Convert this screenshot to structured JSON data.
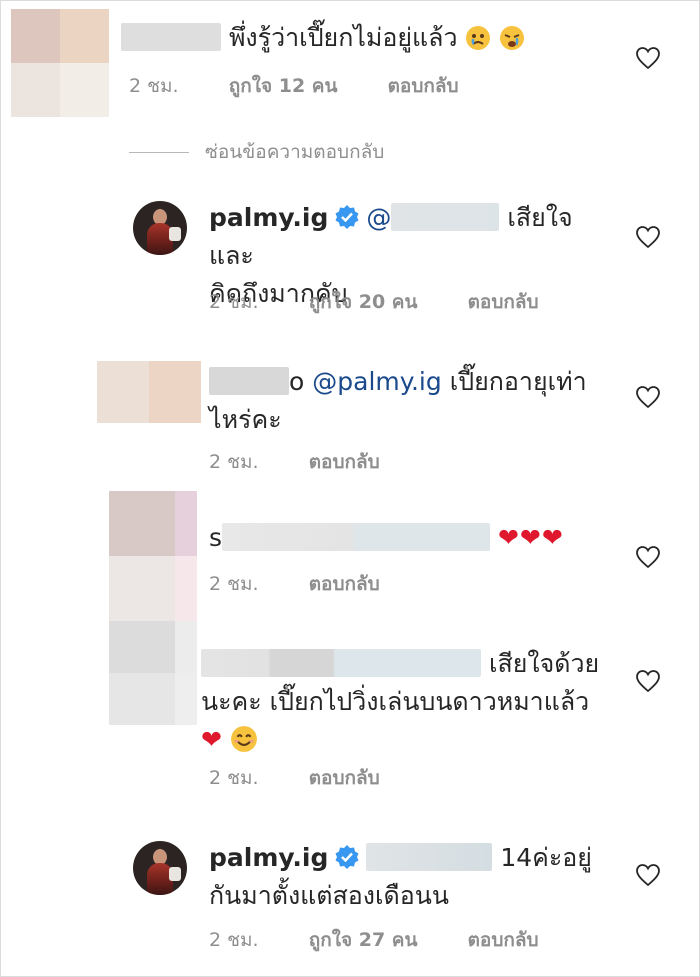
{
  "comments": [
    {
      "text": "พึ่งรู้ว่าเปี๊ยกไม่อยู่แล้ว",
      "emoji": [
        "crying-face-icon",
        "crying-face-icon"
      ],
      "time": "2 ชม.",
      "likes": "ถูกใจ 12 คน",
      "reply": "ตอบกลับ"
    },
    {
      "username": "palmy.ig",
      "mention": "@",
      "text_line1": "เสียใจและ",
      "text_line2": "คิดถึงมากคับ",
      "time": "2 ชม.",
      "likes": "ถูกใจ 20 คน",
      "reply": "ตอบกลับ"
    },
    {
      "username_tail": "o",
      "mention": "@palmy.ig",
      "text_line1": "เปี๊ยกอายุเท่า",
      "text_line2": "ไหร่คะ",
      "time": "2 ชม.",
      "reply": "ตอบกลับ"
    },
    {
      "username_head": "s",
      "hearts": "❤❤❤",
      "time": "2 ชม.",
      "reply": "ตอบกลับ"
    },
    {
      "text_line1": "เสียใจด้วย",
      "text_line2": "นะคะ เปี๊ยกไปวิ่งเล่นบนดาวหมาแล้ว",
      "text_line3_emoji": "❤",
      "time": "2 ชม.",
      "reply": "ตอบกลับ"
    },
    {
      "username": "palmy.ig",
      "text_line1": "14ค่ะอยู่",
      "text_line2": "กันมาตั้งแต่สองเดือนน",
      "time": "2 ชม.",
      "likes": "ถูกใจ 27 คน",
      "reply": "ตอบกลับ"
    }
  ],
  "hide_replies": "ซ่อนข้อความตอบกลับ",
  "colors": {
    "heart_red": "#e0182d",
    "link_blue": "#1a4a8c",
    "meta_gray": "#8e8e8e",
    "verified_blue": "#3897f0"
  }
}
